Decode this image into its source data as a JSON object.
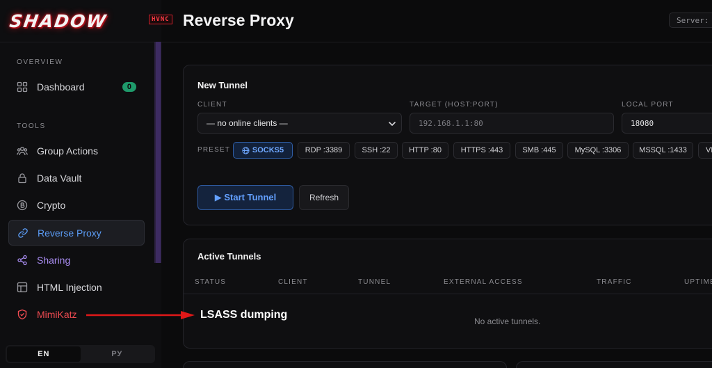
{
  "brand": {
    "logo_text": "SHADOW",
    "badge": "HVNC"
  },
  "header": {
    "title": "Reverse Proxy",
    "server_label": "Server:"
  },
  "sidebar": {
    "overview_label": "OVERVIEW",
    "tools_label": "TOOLS",
    "dashboard": {
      "label": "Dashboard",
      "count": "0"
    },
    "items": [
      {
        "label": "Group Actions",
        "icon": "users-icon"
      },
      {
        "label": "Data Vault",
        "icon": "lock-icon"
      },
      {
        "label": "Crypto",
        "icon": "bitcoin-icon"
      },
      {
        "label": "Reverse Proxy",
        "icon": "link-icon",
        "active": true
      },
      {
        "label": "Sharing",
        "icon": "share-icon"
      },
      {
        "label": "HTML Injection",
        "icon": "grid-icon"
      },
      {
        "label": "MimiKatz",
        "icon": "shield-icon"
      }
    ],
    "lang": {
      "en": "EN",
      "ru": "РУ",
      "selected": "EN"
    }
  },
  "new_tunnel": {
    "title": "New Tunnel",
    "client_label": "CLIENT",
    "client_value": "— no online clients —",
    "target_label": "TARGET (HOST:PORT)",
    "target_placeholder": "192.168.1.1:80",
    "local_port_label": "LOCAL PORT",
    "local_port_value": "18080",
    "preset_label": "PRESET",
    "presets": [
      "SOCKS5",
      "RDP :3389",
      "SSH :22",
      "HTTP :80",
      "HTTPS :443",
      "SMB :445",
      "MySQL :3306",
      "MSSQL :1433",
      "VN"
    ],
    "selected_preset": "SOCKS5",
    "start_button": "▶ Start Tunnel",
    "refresh_button": "Refresh"
  },
  "active_tunnels": {
    "title": "Active Tunnels",
    "columns": [
      "STATUS",
      "CLIENT",
      "TUNNEL",
      "EXTERNAL ACCESS",
      "TRAFFIC",
      "UPTIME"
    ],
    "empty_message": "No active tunnels."
  },
  "annotation": {
    "text": "LSASS dumping",
    "color": "#e01818"
  },
  "colors": {
    "accent_blue": "#5b9cf5",
    "accent_purple": "#a88cf0",
    "danger_red": "#ef4b51",
    "success_green": "#1e9a6b"
  }
}
